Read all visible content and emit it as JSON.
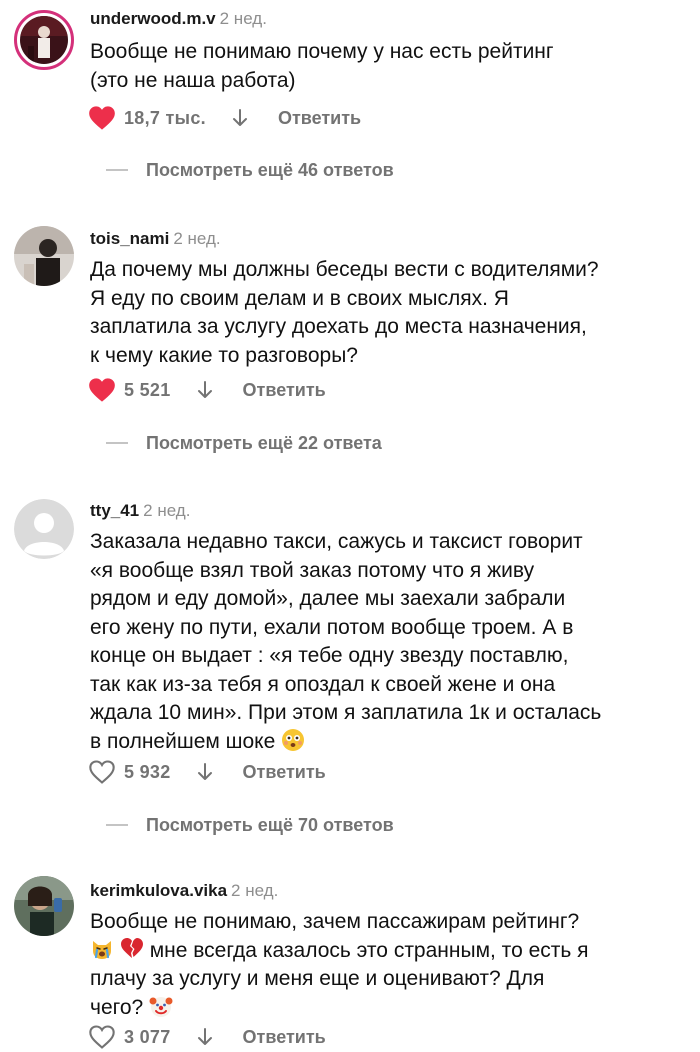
{
  "comments": [
    {
      "username": "underwood.m.v",
      "time": "2 нед.",
      "lines": [
        "Вообще не понимаю почему у нас есть рейтинг",
        "(это не наша работа)"
      ],
      "likes": "18,7 тыс.",
      "liked": true,
      "reply": "Ответить",
      "more": "Посмотреть ещё 46 ответов"
    },
    {
      "username": "tois_nami",
      "time": "2 нед.",
      "lines": [
        "Да почему мы должны беседы вести с водителями?",
        "Я еду по своим делам и в своих мыслях. Я",
        "заплатила за услугу доехать до места назначения,",
        "к чему какие то разговоры?"
      ],
      "likes": "5 521",
      "liked": true,
      "reply": "Ответить",
      "more": "Посмотреть ещё 22 ответа"
    },
    {
      "username": "tty_41",
      "time": "2 нед.",
      "lines": [
        "Заказала недавно такси, сажусь и таксист говорит",
        "«я вообще взял твой заказ потому что я живу",
        "рядом и еду домой», далее мы заехали забрали",
        "его жену по пути, ехали потом вообще троем. А в",
        "конце он выдает : «я тебе одну звезду поставлю,",
        "так как из-за тебя я опоздал к своей жене и она",
        "ждала 10 мин». При этом я заплатила 1к и осталась",
        "в полнейшем шоке"
      ],
      "likes": "5 932",
      "liked": false,
      "reply": "Ответить",
      "more": "Посмотреть ещё 70 ответов"
    },
    {
      "username": "kerimkulova.vika",
      "time": "2 нед.",
      "lines": [
        "Вообще не понимаю, зачем пассажирам рейтинг?",
        "мне всегда казалось это странным, то есть я",
        "плачу за услугу и меня еще и оценивают? Для",
        "чего?"
      ],
      "likes": "3 077",
      "liked": false,
      "reply": "Ответить"
    }
  ],
  "icons": {
    "heart_filled_color": "#ed2f4b",
    "heart_outline_color": "#737373"
  }
}
